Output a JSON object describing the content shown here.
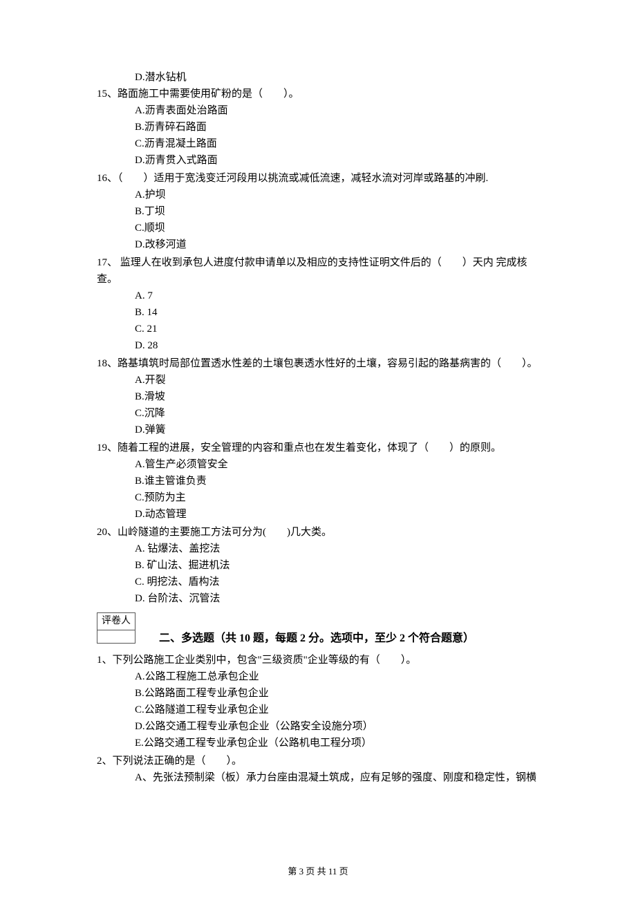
{
  "q14": {
    "optD": "D.潜水钻机"
  },
  "q15": {
    "text": "15、路面施工中需要使用矿粉的是（　　）。",
    "optA": "A.沥青表面处治路面",
    "optB": "B.沥青碎石路面",
    "optC": "C.沥青混凝土路面",
    "optD": "D.沥青贯入式路面"
  },
  "q16": {
    "text": "16、（　　）适用于宽浅变迁河段用以挑流或减低流速，减轻水流对河岸或路基的冲刷.",
    "optA": "A.护坝",
    "optB": "B.丁坝",
    "optC": "C.顺坝",
    "optD": "D.改移河道"
  },
  "q17": {
    "text": "17、 监理人在收到承包人进度付款申请单以及相应的支持性证明文件后的（　　）天内 完成核查。",
    "optA": "A. 7",
    "optB": "B. 14",
    "optC": "C. 21",
    "optD": "D. 28"
  },
  "q18": {
    "text": "18、路基填筑时局部位置透水性差的土壤包裹透水性好的土壤，容易引起的路基病害的（　　）。",
    "optA": "A.开裂",
    "optB": "B.滑坡",
    "optC": "C.沉降",
    "optD": "D.弹簧"
  },
  "q19": {
    "text": "19、随着工程的进展，安全管理的内容和重点也在发生着变化，体现了（　　）的原则。",
    "optA": "A.管生产必须管安全",
    "optB": "B.谁主管谁负责",
    "optC": "C.预防为主",
    "optD": "D.动态管理"
  },
  "q20": {
    "text": "20、山岭隧道的主要施工方法可分为(　　)几大类。",
    "optA": "A. 钻爆法、盖挖法",
    "optB": "B. 矿山法、掘进机法",
    "optC": "C. 明挖法、盾构法",
    "optD": "D. 台阶法、沉管法"
  },
  "graderLabel": "评卷人",
  "sectionTitle": "二、多选题（共 10 题，每题 2 分。选项中，至少 2 个符合题意）",
  "mq1": {
    "text": "1、下列公路施工企业类别中，包含\"三级资质\"企业等级的有（　　）。",
    "optA": "A.公路工程施工总承包企业",
    "optB": "B.公路路面工程专业承包企业",
    "optC": "C.公路隧道工程专业承包企业",
    "optD": "D.公路交通工程专业承包企业（公路安全设施分项）",
    "optE": "E.公路交通工程专业承包企业（公路机电工程分项）"
  },
  "mq2": {
    "text": "2、下列说法正确的是（　　）。",
    "optA": "A、先张法预制梁（板）承力台座由混凝土筑成，应有足够的强度、刚度和稳定性，钢横"
  },
  "footer": "第 3 页 共 11 页"
}
